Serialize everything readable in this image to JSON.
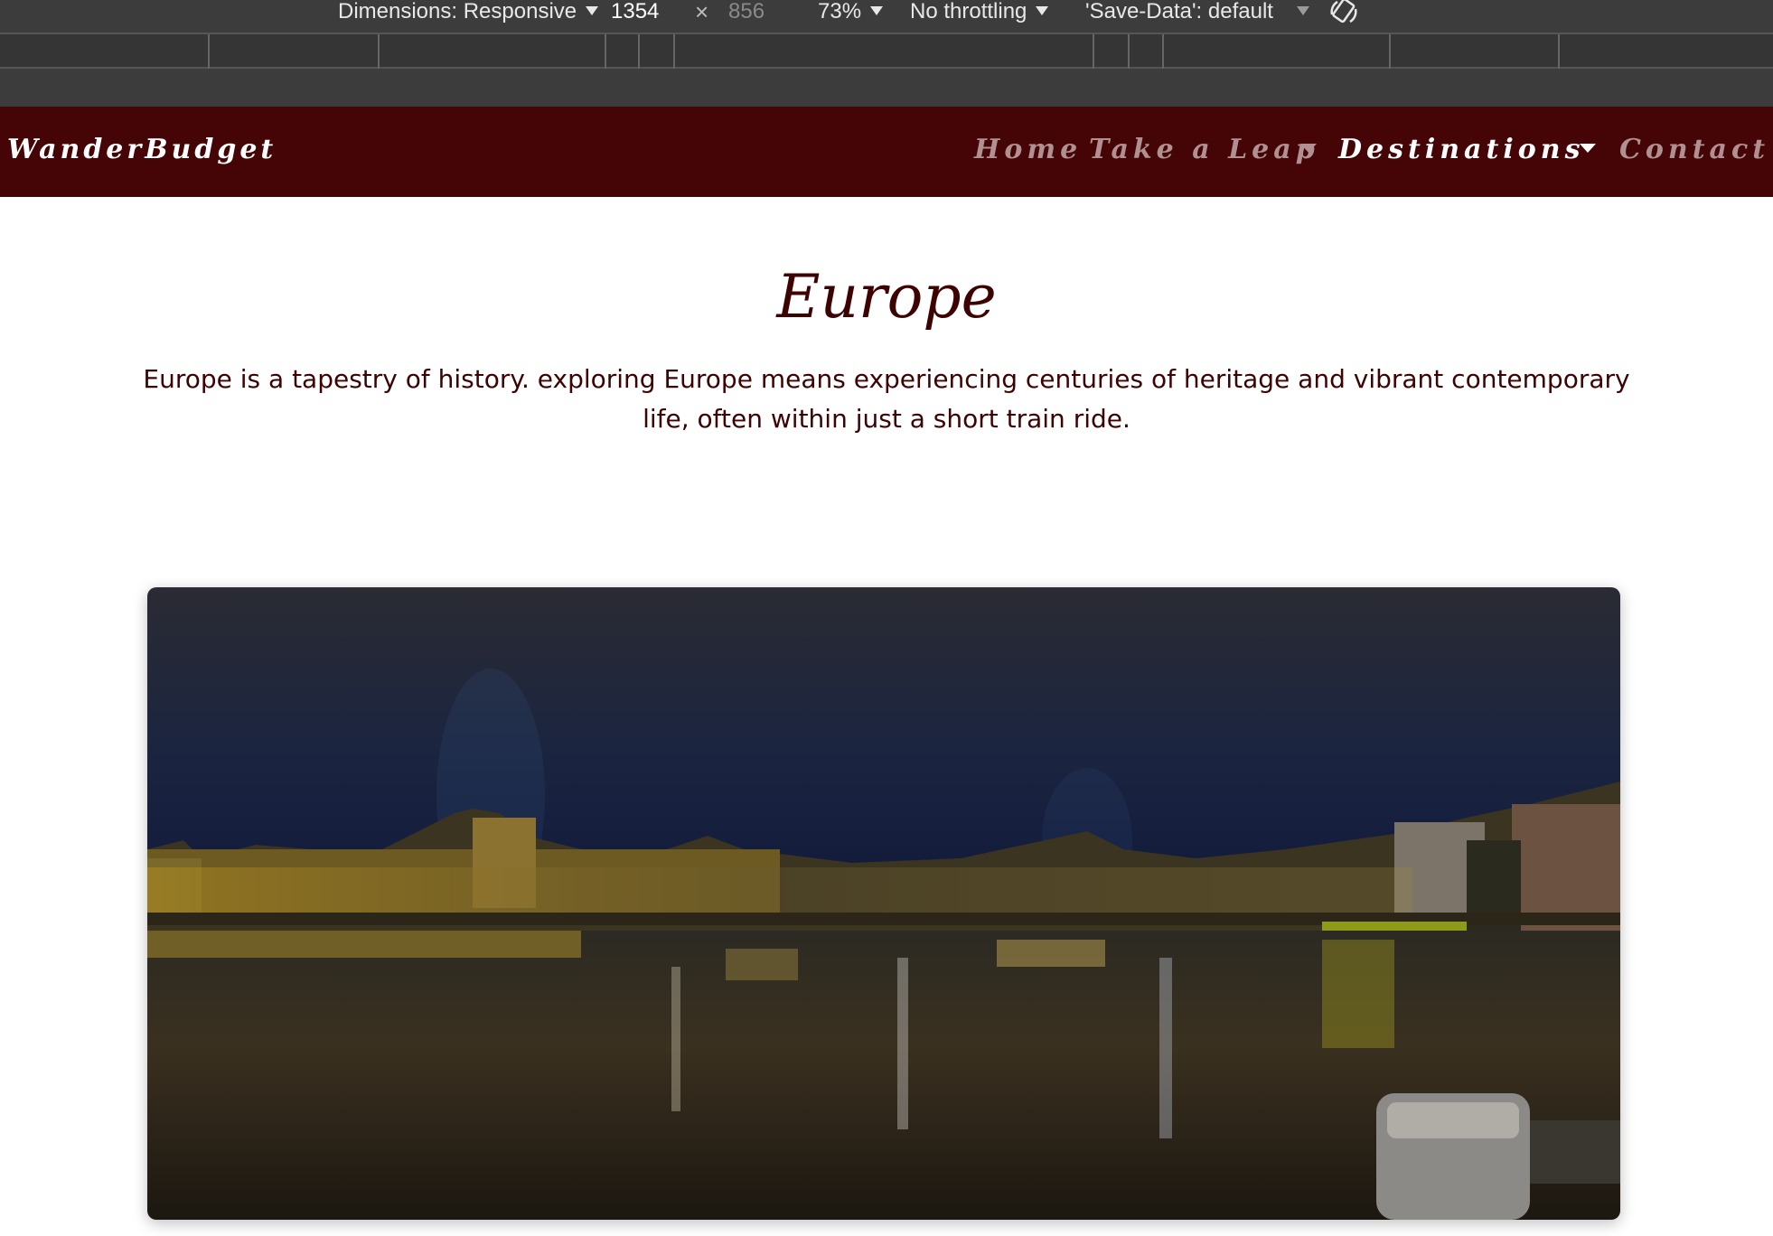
{
  "devtools": {
    "dimensions_label": "Dimensions: Responsive",
    "width_value": "1354",
    "times_symbol": "×",
    "height_value": "856",
    "zoom": "73%",
    "throttling": "No throttling",
    "save_data": "'Save-Data': default",
    "icons": {
      "dimensions_dropdown": "chevron-down-icon",
      "rotate": "rotate-icon"
    }
  },
  "nav": {
    "brand": "WanderBudget",
    "links": [
      {
        "label": "Home",
        "has_dropdown": false,
        "active": false
      },
      {
        "label": "Take a Leap",
        "has_dropdown": true,
        "active": false
      },
      {
        "label": "Destinations",
        "has_dropdown": true,
        "active": true
      },
      {
        "label": "Contact",
        "has_dropdown": false,
        "active": false
      }
    ]
  },
  "hero": {
    "title": "Europe",
    "description": "Europe is a tapestry of history. exploring Europe means experiencing centuries of heritage and vibrant contemporary life, often within just a short train ride."
  },
  "colors": {
    "nav_background": "#450405",
    "text_dark_red": "#3d0303",
    "nav_inactive": "#b09090",
    "nav_active": "#ffffff",
    "devtools_background": "#3c3c3c"
  }
}
